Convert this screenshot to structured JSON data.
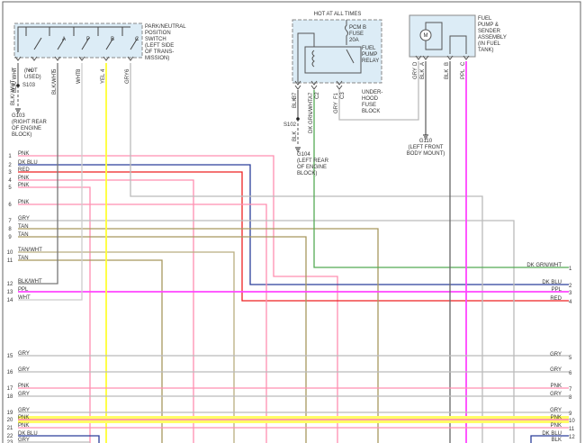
{
  "colors": {
    "PNK": "#ff8fb0",
    "DK BLU": "#2b3f9a",
    "RED": "#ee2222",
    "GRY": "#bbbbbb",
    "TAN": "#a8975e",
    "TAN/WHT": "#b9ad80",
    "BLK/WHT": "#777777",
    "PPL": "#ff44ff",
    "WHT": "#cccccc",
    "YEL": "#ffff33",
    "DK GRN/WHT": "#55aa55",
    "BLK": "#666666",
    "box": "#dcecf6",
    "highlight": "#ffff66"
  },
  "pnp_switch": {
    "label": [
      "PARK/NEUTRAL",
      "POSITION",
      "SWITCH",
      "(LEFT SIDE",
      "OF TRANS-",
      "MISSION)"
    ],
    "pins": [
      {
        "wire": "BLK/ WHT",
        "pin": "7",
        "letter": ""
      },
      {
        "wire": "",
        "pin": "3",
        "letter": ""
      },
      {
        "wire": "BLK/WHT",
        "pin": "5",
        "letter": "A"
      },
      {
        "wire": "WHT",
        "pin": "8",
        "letter": "P"
      },
      {
        "wire": "YEL",
        "pin": "4",
        "letter": "B"
      },
      {
        "wire": "GRY",
        "pin": "6",
        "letter": "C"
      }
    ],
    "not_used": [
      "(NOT",
      "USED)"
    ],
    "splice": "S103",
    "ground_wire": "BLK/ WHT",
    "ground": [
      "G103",
      "(RIGHT REAR",
      "OF ENGINE",
      "BLOCK)"
    ]
  },
  "fuse_block": {
    "hot_label": "HOT AT ALL TIMES",
    "fuse": [
      "PCM B",
      "FUSE",
      "20A"
    ],
    "relay": [
      "FUEL",
      "PUMP",
      "RELAY"
    ],
    "label": [
      "UNDER-",
      "HOOD",
      "FUSE",
      "BLOCK"
    ],
    "pins": [
      {
        "wire": "BLK",
        "pin": "B7",
        "conn": ""
      },
      {
        "wire": "DK GRN/WHT",
        "pin": "A7",
        "conn": "C2"
      },
      {
        "wire": "GRY",
        "pin": "F1",
        "conn": "C3"
      }
    ],
    "splice": "S102",
    "ground_wire": "BLK",
    "ground": [
      "G104",
      "(LEFT REAR",
      "OF ENGINE",
      "BLOCK)"
    ]
  },
  "fuel_pump": {
    "label": [
      "FUEL",
      "PUMP &",
      "SENDER",
      "ASSEMBLY",
      "(IN FUEL",
      "TANK)"
    ],
    "motor": "M",
    "pins": [
      {
        "wire": "GRY",
        "pin": "D"
      },
      {
        "wire": "BLK",
        "pin": "A"
      },
      {
        "wire": "BLK",
        "pin": "B"
      },
      {
        "wire": "PPL",
        "pin": "C"
      }
    ],
    "ground": [
      "G110",
      "(LEFT FRONT",
      "BODY MOUNT)"
    ]
  },
  "left_rows": [
    {
      "n": "1",
      "label": "PNK"
    },
    {
      "n": "2",
      "label": "DK BLU"
    },
    {
      "n": "3",
      "label": "RED"
    },
    {
      "n": "4",
      "label": "PNK"
    },
    {
      "n": "5",
      "label": "PNK"
    },
    {
      "n": "6",
      "label": "PNK"
    },
    {
      "n": "7",
      "label": "GRY"
    },
    {
      "n": "8",
      "label": "TAN"
    },
    {
      "n": "9",
      "label": "TAN"
    },
    {
      "n": "10",
      "label": "TAN/WHT"
    },
    {
      "n": "11",
      "label": "TAN"
    },
    {
      "n": "12",
      "label": "BLK/WHT"
    },
    {
      "n": "13",
      "label": "PPL"
    },
    {
      "n": "14",
      "label": "WHT"
    },
    {
      "n": "15",
      "label": "GRY"
    },
    {
      "n": "16",
      "label": "GRY"
    },
    {
      "n": "17",
      "label": "PNK"
    },
    {
      "n": "18",
      "label": "GRY"
    },
    {
      "n": "19",
      "label": "GRY"
    },
    {
      "n": "20",
      "label": "PNK"
    },
    {
      "n": "21",
      "label": "PNK"
    },
    {
      "n": "22",
      "label": "DK BLU"
    },
    {
      "n": "23",
      "label": "GRY"
    }
  ],
  "right_rows": [
    {
      "n": "1",
      "label": "DK GRN/WHT"
    },
    {
      "n": "2",
      "label": "DK BLU"
    },
    {
      "n": "3",
      "label": "PPL"
    },
    {
      "n": "4",
      "label": "RED"
    },
    {
      "n": "5",
      "label": "GRY"
    },
    {
      "n": "6",
      "label": "GRY"
    },
    {
      "n": "7",
      "label": "PNK"
    },
    {
      "n": "8",
      "label": "GRY"
    },
    {
      "n": "9",
      "label": "GRY"
    },
    {
      "n": "10",
      "label": "PNK"
    },
    {
      "n": "11",
      "label": "PNK"
    },
    {
      "n": "12",
      "label": "DK BLU"
    },
    {
      "n": "",
      "label": "BLK"
    }
  ]
}
